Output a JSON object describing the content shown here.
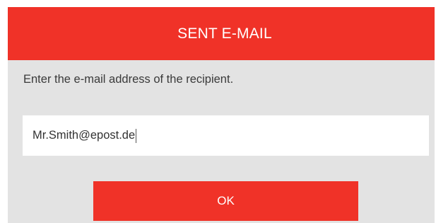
{
  "dialog": {
    "title": "SENT E-MAIL",
    "instruction": "Enter the e-mail address of the recipient.",
    "email_field": {
      "value": "Mr.Smith@epost.de"
    },
    "ok_label": "OK"
  },
  "colors": {
    "accent": "#f03228",
    "panel_background": "#e3e3e3",
    "field_background": "#ffffff",
    "title_text": "#ffffff",
    "body_text": "#3a3a3a"
  }
}
